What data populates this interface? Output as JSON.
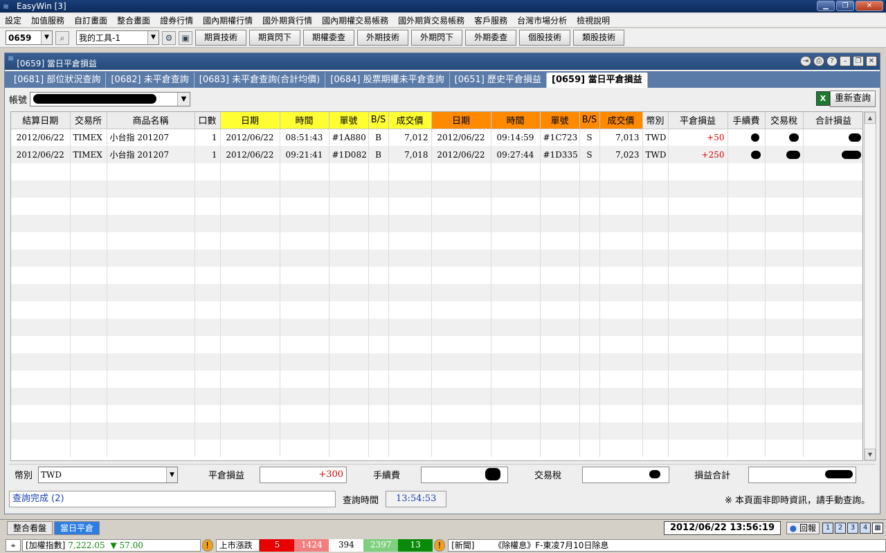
{
  "app": {
    "title": "EasyWin  [3]"
  },
  "menu": [
    "設定",
    "加值服務",
    "自訂畫面",
    "整合畫面",
    "證券行情",
    "國內期權行情",
    "國外期貨行情",
    "國內期權交易帳務",
    "國外期貨交易帳務",
    "客戶服務",
    "台灣市場分析",
    "檢視說明"
  ],
  "toolbar": {
    "code": "0659",
    "tool": "我的工具-1",
    "buttons": [
      "期貨技術",
      "期貨閃下",
      "期權委查",
      "外期技術",
      "外期閃下",
      "外期委查",
      "個股技術",
      "類股技術"
    ]
  },
  "window": {
    "title": "[0659] 當日平倉損益",
    "tabs": [
      "[0681] 部位狀況查詢",
      "[0682] 未平倉查詢",
      "[0683] 未平倉查詢(合計均價)",
      "[0684] 股票期權未平倉查詢",
      "[0651] 歷史平倉損益",
      "[0659] 當日平倉損益"
    ],
    "active_tab": 5
  },
  "account": {
    "label": "帳號",
    "requery_label": "重新查詢"
  },
  "table": {
    "headers": [
      "結算日期",
      "交易所",
      "商品名稱",
      "口數",
      "日期",
      "時間",
      "單號",
      "B/S",
      "成交價",
      "日期",
      "時間",
      "單號",
      "B/S",
      "成交價",
      "幣別",
      "平倉損益",
      "手續費",
      "交易稅",
      "合計損益"
    ],
    "rows": [
      [
        "2012/06/22",
        "TIMEX",
        "小台指 201207",
        "1",
        "2012/06/22",
        "08:51:43",
        "#1A880",
        "B",
        "7,012",
        "2012/06/22",
        "09:14:59",
        "#1C723",
        "S",
        "7,013",
        "TWD",
        "+50"
      ],
      [
        "2012/06/22",
        "TIMEX",
        "小台指 201207",
        "1",
        "2012/06/22",
        "09:21:41",
        "#1D082",
        "B",
        "7,018",
        "2012/06/22",
        "09:27:44",
        "#1D335",
        "S",
        "7,023",
        "TWD",
        "+250"
      ]
    ]
  },
  "summary": {
    "currency_label": "幣別",
    "currency": "TWD",
    "pnl_label": "平倉損益",
    "pnl": "+300",
    "fee_label": "手續費",
    "tax_label": "交易稅",
    "total_label": "損益合計"
  },
  "status": {
    "message": "查詢完成 (2)",
    "time_label": "查詢時間",
    "time": "13:54:53",
    "note": "※ 本頁面非即時資訊，請手動查詢。"
  },
  "bottom": {
    "tabs": [
      "整合看盤",
      "當日平倉"
    ],
    "active_tab": 1,
    "datetime": "2012/06/22 13:56:19",
    "replay": "回報",
    "squares": [
      "1",
      "2",
      "3",
      "4"
    ]
  },
  "ticker": {
    "index_label": "[加權指數]",
    "index_value": "7,222.05",
    "index_change": "▼ 57.00",
    "breadth_label": "上市漲跌",
    "breadth": [
      "5",
      "1424",
      "394",
      "2397",
      "13"
    ],
    "news_label": "[新聞]",
    "news": "《除權息》F-東凌7月10日除息"
  }
}
